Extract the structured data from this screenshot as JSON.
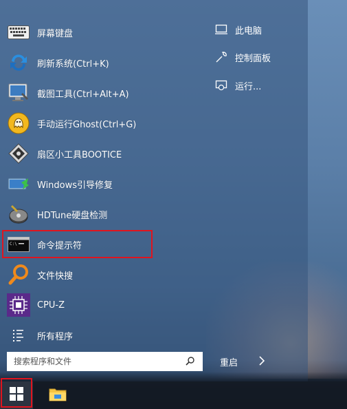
{
  "start_menu": {
    "apps": [
      {
        "label": "屏幕键盘",
        "icon": "keyboard-icon"
      },
      {
        "label": "刷新系统(Ctrl+K)",
        "icon": "refresh-icon"
      },
      {
        "label": "截图工具(Ctrl+Alt+A)",
        "icon": "screenshot-icon"
      },
      {
        "label": "手动运行Ghost(Ctrl+G)",
        "icon": "ghost-icon"
      },
      {
        "label": "扇区小工具BOOTICE",
        "icon": "disk-tool-icon"
      },
      {
        "label": "Windows引导修复",
        "icon": "boot-repair-icon"
      },
      {
        "label": "HDTune硬盘检测",
        "icon": "hdtune-icon"
      },
      {
        "label": "命令提示符",
        "icon": "cmd-icon"
      },
      {
        "label": "文件快搜",
        "icon": "search-file-icon"
      },
      {
        "label": "CPU-Z",
        "icon": "cpu-icon"
      },
      {
        "label": "所有程序",
        "icon": "all-programs-icon"
      }
    ],
    "right_items": [
      {
        "label": "此电脑",
        "icon": "computer-icon"
      },
      {
        "label": "控制面板",
        "icon": "wrench-icon"
      },
      {
        "label": "运行...",
        "icon": "run-icon"
      }
    ],
    "search": {
      "placeholder": "搜索程序和文件"
    },
    "restart": {
      "label": "重启"
    }
  },
  "colors": {
    "highlight": "#e0141e",
    "menu_bg": "rgba(55,85,125,0.55)",
    "taskbar_bg": "#141a24"
  }
}
